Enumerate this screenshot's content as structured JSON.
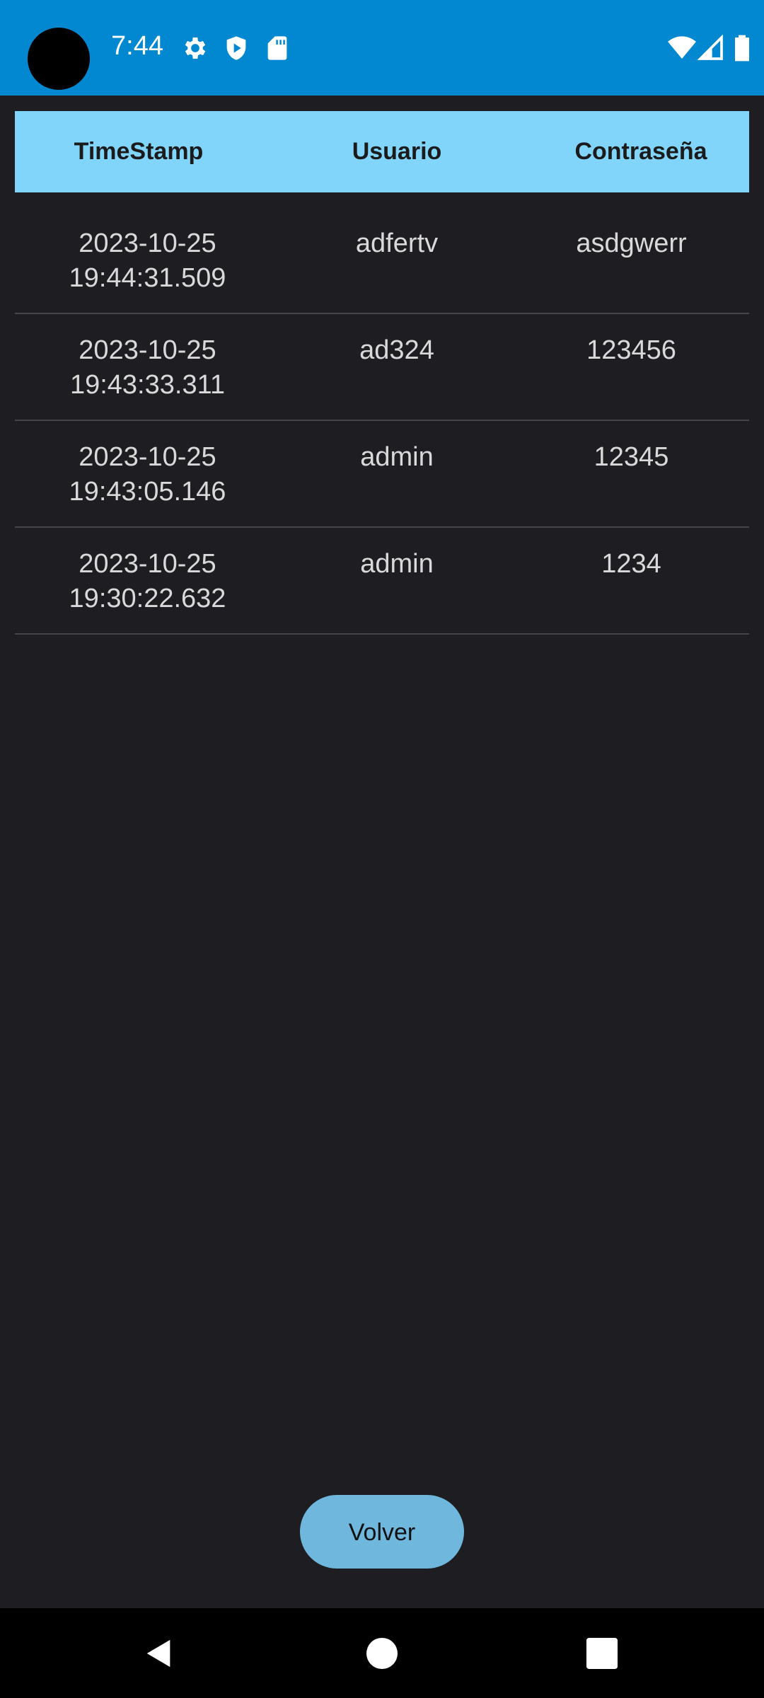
{
  "status_bar": {
    "time": "7:44",
    "left_icons": [
      "gear-icon",
      "shield-play-icon",
      "sd-card-icon"
    ],
    "right_icons": [
      "wifi-icon",
      "signal-icon",
      "battery-icon"
    ]
  },
  "table": {
    "headers": [
      "TimeStamp",
      "Usuario",
      "Contraseña"
    ],
    "rows": [
      {
        "timestamp_date": "2023-10-25",
        "timestamp_time": "19:44:31.509",
        "usuario": "adfertv",
        "contrasena": "asdgwerr"
      },
      {
        "timestamp_date": "2023-10-25",
        "timestamp_time": "19:43:33.311",
        "usuario": "ad324",
        "contrasena": "123456"
      },
      {
        "timestamp_date": "2023-10-25",
        "timestamp_time": "19:43:05.146",
        "usuario": "admin",
        "contrasena": "12345"
      },
      {
        "timestamp_date": "2023-10-25",
        "timestamp_time": "19:30:22.632",
        "usuario": "admin",
        "contrasena": "1234"
      }
    ]
  },
  "back_button": {
    "label": "Volver"
  },
  "nav_bar": {
    "icons": [
      "back-icon",
      "home-icon",
      "recents-icon"
    ]
  },
  "colors": {
    "status_bar": "#0288d1",
    "header_bg": "#81d4fa",
    "background": "#1e1d22",
    "button": "#6fb7dc"
  }
}
